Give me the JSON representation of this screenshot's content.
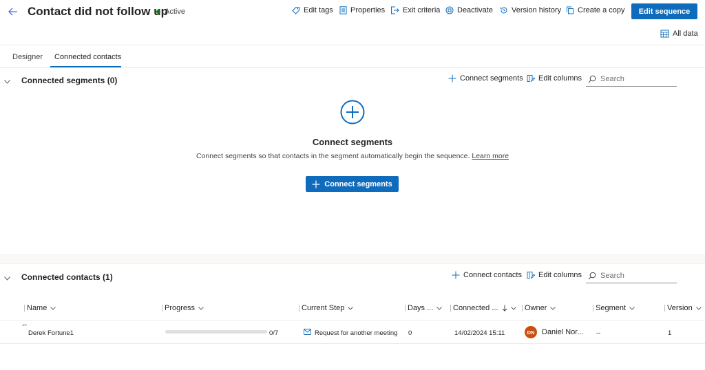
{
  "header": {
    "title": "Contact did not follow up",
    "status": "Active",
    "commands": {
      "edit_tags": "Edit tags",
      "properties": "Properties",
      "exit_criteria": "Exit criteria",
      "deactivate": "Deactivate",
      "version_history": "Version history",
      "create_copy": "Create a copy"
    },
    "edit_sequence": "Edit sequence",
    "all_data": "All data"
  },
  "tabs": [
    "Designer",
    "Connected contacts"
  ],
  "segments": {
    "title": "Connected segments (0)",
    "connect_label": "Connect segments",
    "edit_columns": "Edit columns",
    "search_placeholder": "Search",
    "empty_title": "Connect segments",
    "empty_desc": "Connect segments so that contacts in the segment automatically begin the sequence.",
    "learn_more": "Learn more",
    "button_label": "Connect segments"
  },
  "contacts": {
    "title": "Connected contacts (1)",
    "connect_label": "Connect contacts",
    "edit_columns": "Edit columns",
    "search_placeholder": "Search",
    "columns": [
      "Name",
      "Progress",
      "Current Step",
      "Days ...",
      "Connected ...",
      "Owner",
      "Segment",
      "Version"
    ],
    "rows": [
      {
        "name": "Derek Fortune1",
        "progress_fraction": 0,
        "progress_text": "0/7",
        "current_step": "Request for another meeting",
        "days": "0",
        "connected": "14/02/2024 15:11",
        "owner_initials": "DN",
        "owner": "Daniel Nor...",
        "segment": "--",
        "version": "1"
      }
    ]
  },
  "colors": {
    "accent": "#0f6cbd",
    "status_active": "#107c10",
    "avatar": "#ca5010"
  }
}
